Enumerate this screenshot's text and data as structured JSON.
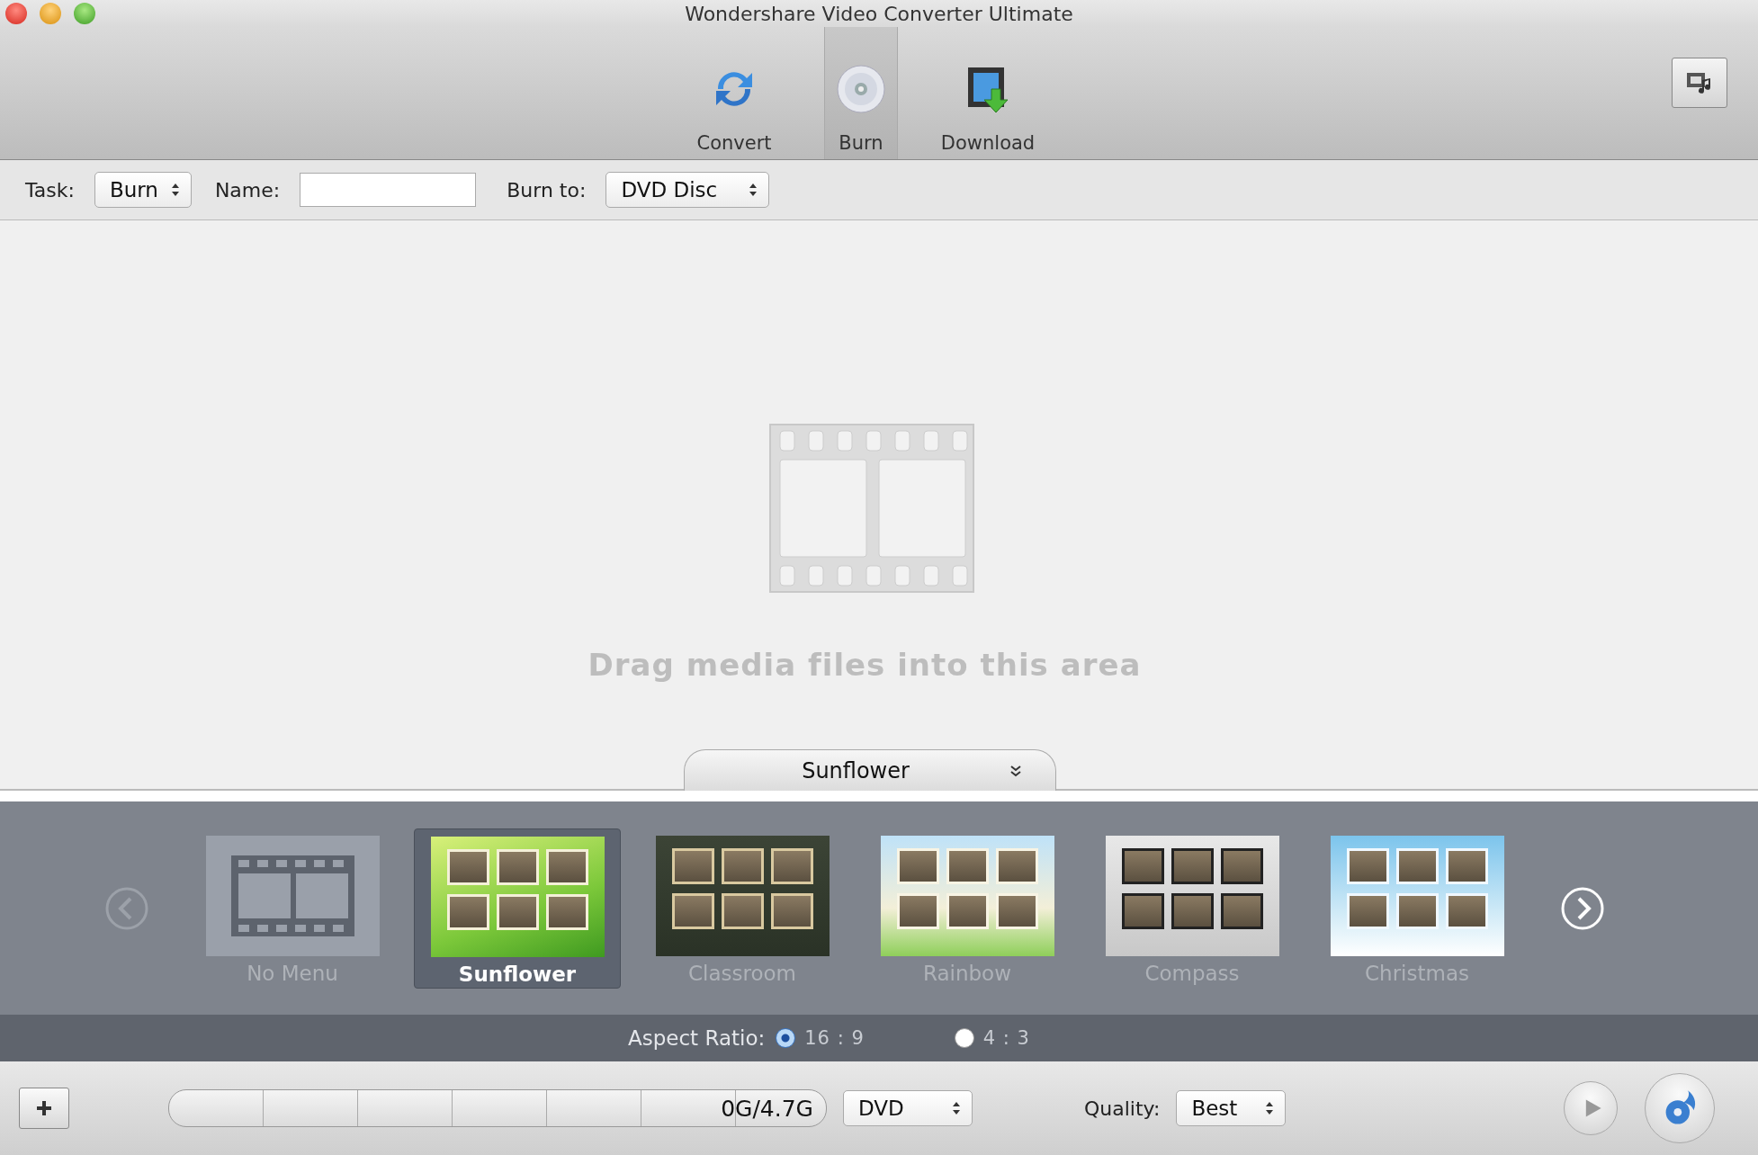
{
  "window": {
    "title": "Wondershare Video Converter Ultimate"
  },
  "toolbar": {
    "tabs": [
      {
        "label": "Convert",
        "kind": "convert",
        "selected": false
      },
      {
        "label": "Burn",
        "kind": "burn",
        "selected": true
      },
      {
        "label": "Download",
        "kind": "download",
        "selected": false
      }
    ]
  },
  "task_bar": {
    "task": {
      "label": "Task:",
      "value": "Burn"
    },
    "name": {
      "label": "Name:"
    },
    "burn_to": {
      "label": "Burn to:",
      "value": "DVD Disc"
    }
  },
  "drop_area": {
    "message": "Drag media files into this area"
  },
  "menu_selector": {
    "value": "Sunflower"
  },
  "template_nav": [
    {
      "kind": "prev",
      "disabled": true
    },
    {
      "kind": "next",
      "disabled": false
    }
  ],
  "templates": [
    {
      "label": "No Menu",
      "kind": "none",
      "selected": false
    },
    {
      "label": "Sunflower",
      "kind": "sunflower",
      "selected": true
    },
    {
      "label": "Classroom",
      "kind": "classroom",
      "selected": false
    },
    {
      "label": "Rainbow",
      "kind": "rainbow",
      "selected": false
    },
    {
      "label": "Compass",
      "kind": "compass",
      "selected": false
    },
    {
      "label": "Christmas",
      "kind": "christmas",
      "selected": false
    }
  ],
  "aspect_ratio": {
    "label": "Aspect Ratio:",
    "options": [
      {
        "label": "16 : 9",
        "selected": true
      },
      {
        "label": "4 : 3",
        "selected": false
      }
    ]
  },
  "bottom_bar": {
    "capacity": {
      "text": "0G/4.7G"
    },
    "disc_type": {
      "value": "DVD"
    },
    "quality": {
      "label": "Quality:",
      "value": "Best"
    }
  }
}
